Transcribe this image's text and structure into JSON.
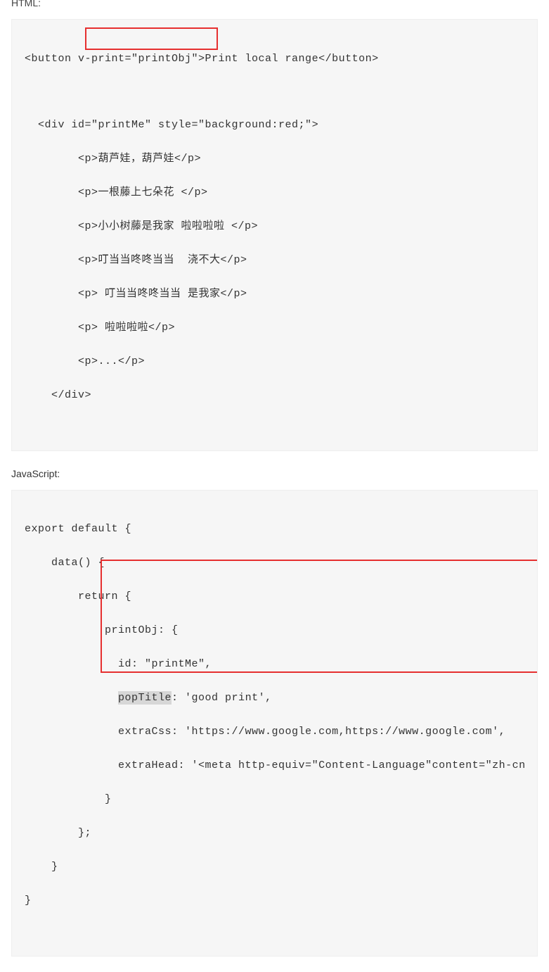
{
  "labels": {
    "html_label": "HTML:",
    "js_label": "JavaScript:"
  },
  "html_code": [
    "<button v-print=\"printObj\">Print local range</button>",
    "",
    "  <div id=\"printMe\" style=\"background:red;\">",
    "        <p>葫芦娃，葫芦娃</p>",
    "        <p>一根藤上七朵花 </p>",
    "        <p>小小树藤是我家 啦啦啦啦 </p>",
    "        <p>叮当当咚咚当当  浇不大</p>",
    "        <p> 叮当当咚咚当当 是我家</p>",
    "        <p> 啦啦啦啦</p>",
    "        <p>...</p>",
    "    </div>"
  ],
  "js_code": {
    "l1": "export default {",
    "l2": "    data() {",
    "l3": "        return {",
    "l4": "            printObj: {",
    "l5": "              id: \"printMe\",",
    "l6a": "              ",
    "l6h": "popTitle",
    "l6b": ": 'good print',",
    "l7": "              extraCss: 'https://www.google.com,https://www.google.com',",
    "l8": "              extraHead: '<meta http-equiv=\"Content-Language\"content=\"zh-cn",
    "l9": "            }",
    "l10": "        };",
    "l11": "    }",
    "l12": "}"
  }
}
